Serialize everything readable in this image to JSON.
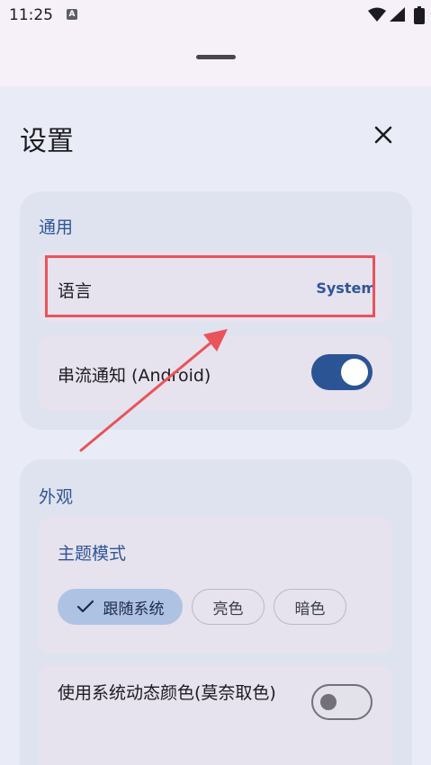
{
  "status_bar": {
    "time": "11:25",
    "notification_icon_letter": "A",
    "icons": [
      "wifi-icon",
      "signal-icon",
      "battery-icon"
    ]
  },
  "header": {
    "title": "设置",
    "close_icon": "close-icon"
  },
  "general": {
    "section_title": "通用",
    "language": {
      "label": "语言",
      "value": "System"
    },
    "streaming_notification": {
      "label": "串流通知 (Android)",
      "enabled": true
    }
  },
  "appearance": {
    "section_title": "外观",
    "theme_mode": {
      "label": "主题模式",
      "options": [
        {
          "label": "跟随系统",
          "selected": true
        },
        {
          "label": "亮色",
          "selected": false
        },
        {
          "label": "暗色",
          "selected": false
        }
      ]
    },
    "dynamic_color": {
      "label": "使用系统动态颜色(莫奈取色)",
      "enabled": false
    }
  },
  "colors": {
    "accent": "#2f5596",
    "annotation": "#e9545b",
    "card": "#dfe3ef",
    "background": "#e9ecf7"
  }
}
